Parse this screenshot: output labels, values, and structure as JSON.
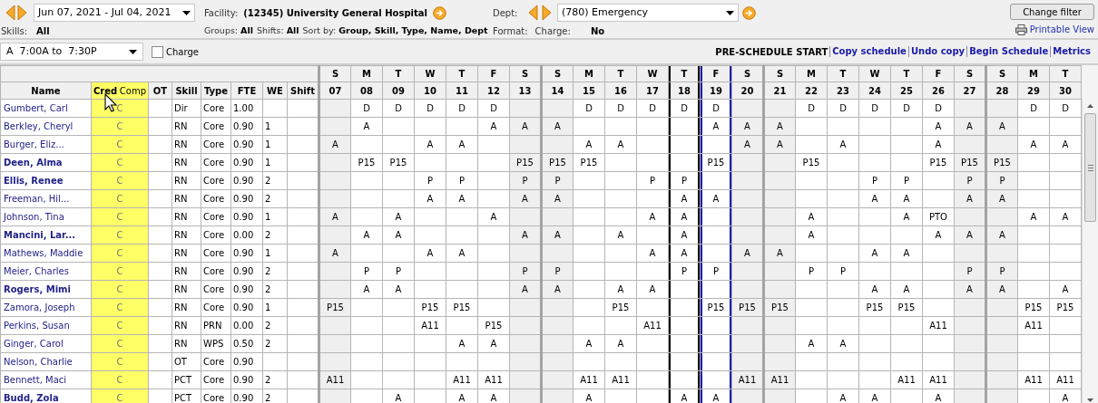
{
  "toolbar": {
    "date_range": "Jun 07, 2021 - Jul 04, 2021",
    "facility_label": "Facility:",
    "facility": "(12345) University General Hospital",
    "dept_label": "Dept:",
    "dept": "(780) Emergency",
    "change_filter": "Change filter",
    "printable_view": "Printable View"
  },
  "skills": {
    "label": "Skills:",
    "value": "All"
  },
  "filters_left": [
    {
      "label": "Groups:",
      "value": "All"
    },
    {
      "label": "Shifts:",
      "value": "All"
    },
    {
      "label": "Sort by:",
      "value": "Group, Skill, Type, Name, Dept"
    }
  ],
  "filters_right": [
    {
      "label": "Format:"
    },
    {
      "label": "Charge:",
      "value": "No"
    }
  ],
  "shift_select": "A  7:00A to  7:30P",
  "charge_checkbox": {
    "label": "Charge",
    "checked": false
  },
  "status": "PRE-SCHEDULE START",
  "links": [
    "Copy schedule",
    "Undo copy",
    "Begin Schedule",
    "Metrics"
  ],
  "columns": [
    "Name",
    "Cred",
    "Comp",
    "OT",
    "Skill",
    "Type",
    "FTE",
    "WE",
    "Shift"
  ],
  "days": [
    {
      "weekday": "S",
      "date": "07",
      "weekend": true,
      "today": false,
      "selected": false
    },
    {
      "weekday": "M",
      "date": "08",
      "weekend": false,
      "today": false,
      "selected": false
    },
    {
      "weekday": "T",
      "date": "09",
      "weekend": false,
      "today": false,
      "selected": false
    },
    {
      "weekday": "W",
      "date": "10",
      "weekend": false,
      "today": false,
      "selected": false
    },
    {
      "weekday": "T",
      "date": "11",
      "weekend": false,
      "today": false,
      "selected": false
    },
    {
      "weekday": "F",
      "date": "12",
      "weekend": false,
      "today": false,
      "selected": false
    },
    {
      "weekday": "S",
      "date": "13",
      "weekend": true,
      "today": false,
      "selected": false
    },
    {
      "weekday": "S",
      "date": "14",
      "weekend": true,
      "today": false,
      "selected": false
    },
    {
      "weekday": "M",
      "date": "15",
      "weekend": false,
      "today": false,
      "selected": false
    },
    {
      "weekday": "T",
      "date": "16",
      "weekend": false,
      "today": false,
      "selected": false
    },
    {
      "weekday": "W",
      "date": "17",
      "weekend": false,
      "today": false,
      "selected": false
    },
    {
      "weekday": "T",
      "date": "18",
      "weekend": false,
      "today": true,
      "selected": false
    },
    {
      "weekday": "F",
      "date": "19",
      "weekend": false,
      "today": false,
      "selected": true
    },
    {
      "weekday": "S",
      "date": "20",
      "weekend": true,
      "today": false,
      "selected": false
    },
    {
      "weekday": "S",
      "date": "21",
      "weekend": true,
      "today": false,
      "selected": false
    },
    {
      "weekday": "M",
      "date": "22",
      "weekend": false,
      "today": false,
      "selected": false
    },
    {
      "weekday": "T",
      "date": "23",
      "weekend": false,
      "today": false,
      "selected": false
    },
    {
      "weekday": "W",
      "date": "24",
      "weekend": false,
      "today": false,
      "selected": false
    },
    {
      "weekday": "T",
      "date": "25",
      "weekend": false,
      "today": false,
      "selected": false
    },
    {
      "weekday": "F",
      "date": "26",
      "weekend": false,
      "today": false,
      "selected": false
    },
    {
      "weekday": "S",
      "date": "27",
      "weekend": true,
      "today": false,
      "selected": false
    },
    {
      "weekday": "S",
      "date": "28",
      "weekend": true,
      "today": false,
      "selected": false
    },
    {
      "weekday": "M",
      "date": "29",
      "weekend": false,
      "today": false,
      "selected": false
    },
    {
      "weekday": "T",
      "date": "30",
      "weekend": false,
      "today": false,
      "selected": false
    }
  ],
  "rows": [
    {
      "name": "Gumbert, Carl",
      "bold": false,
      "cred": "C",
      "skill": "Dir",
      "type": "Core",
      "fte": "1.00",
      "shifts": [
        {
          "kind": "empty"
        },
        {
          "kind": "shift",
          "code": "D"
        },
        {
          "kind": "shift",
          "code": "D"
        },
        {
          "kind": "shift",
          "code": "D"
        },
        {
          "kind": "shift",
          "code": "D"
        },
        {
          "kind": "shift",
          "code": "D"
        },
        {
          "kind": "empty"
        },
        {
          "kind": "empty"
        },
        {
          "kind": "shift",
          "code": "D"
        },
        {
          "kind": "shift",
          "code": "D"
        },
        {
          "kind": "shift",
          "code": "D"
        },
        {
          "kind": "shift",
          "code": "D"
        },
        {
          "kind": "shift",
          "code": "D"
        },
        {
          "kind": "empty"
        },
        {
          "kind": "empty"
        },
        {
          "kind": "shift",
          "code": "D"
        },
        {
          "kind": "shift",
          "code": "D"
        },
        {
          "kind": "shift",
          "code": "D"
        },
        {
          "kind": "shift",
          "code": "D"
        },
        {
          "kind": "shift",
          "code": "D"
        },
        {
          "kind": "empty"
        },
        {
          "kind": "empty"
        },
        {
          "kind": "shift",
          "code": "D"
        },
        {
          "kind": "shift",
          "code": "D"
        }
      ]
    },
    {
      "name": "Berkley, Cheryl",
      "bold": false,
      "cred": "C",
      "skill": "RN",
      "type": "Core",
      "fte": "0.90",
      "we": "1",
      "shifts": [
        {
          "kind": "empty"
        },
        {
          "kind": "shift",
          "code": "A"
        },
        {
          "kind": "empty"
        },
        {
          "kind": "empty"
        },
        {
          "kind": "empty"
        },
        {
          "kind": "shift",
          "code": "A"
        },
        {
          "kind": "shift",
          "code": "A"
        },
        {
          "kind": "shift",
          "code": "A"
        },
        {
          "kind": "empty"
        },
        {
          "kind": "empty"
        },
        {
          "kind": "empty"
        },
        {
          "kind": "empty"
        },
        {
          "kind": "shift",
          "code": "A"
        },
        {
          "kind": "shift",
          "code": "A"
        },
        {
          "kind": "shift",
          "code": "A"
        },
        {
          "kind": "empty"
        },
        {
          "kind": "empty"
        },
        {
          "kind": "empty"
        },
        {
          "kind": "empty"
        },
        {
          "kind": "shift",
          "code": "A"
        },
        {
          "kind": "shift",
          "code": "A"
        },
        {
          "kind": "shift",
          "code": "A"
        },
        {
          "kind": "empty"
        },
        {
          "kind": "empty"
        }
      ]
    },
    {
      "name": "Burger, Eliz...",
      "bold": false,
      "cred": "C",
      "skill": "RN",
      "type": "Core",
      "fte": "0.90",
      "we": "1",
      "shifts": [
        {
          "kind": "shift",
          "code": "A"
        },
        {
          "kind": "empty"
        },
        {
          "kind": "empty"
        },
        {
          "kind": "shift",
          "code": "A"
        },
        {
          "kind": "shift",
          "code": "A"
        },
        {
          "kind": "empty"
        },
        {
          "kind": "empty"
        },
        {
          "kind": "empty"
        },
        {
          "kind": "shift",
          "code": "A"
        },
        {
          "kind": "shift",
          "code": "A"
        },
        {
          "kind": "empty"
        },
        {
          "kind": "empty"
        },
        {
          "kind": "empty"
        },
        {
          "kind": "shift",
          "code": "A"
        },
        {
          "kind": "shift",
          "code": "A"
        },
        {
          "kind": "empty"
        },
        {
          "kind": "shift",
          "code": "A"
        },
        {
          "kind": "empty"
        },
        {
          "kind": "empty"
        },
        {
          "kind": "shift",
          "code": "A"
        },
        {
          "kind": "empty"
        },
        {
          "kind": "empty"
        },
        {
          "kind": "shift",
          "code": "A"
        },
        {
          "kind": "shift",
          "code": "A"
        }
      ]
    },
    {
      "name": "Deen, Alma",
      "bold": true,
      "cred": "C",
      "skill": "RN",
      "type": "Core",
      "fte": "0.90",
      "we": "1",
      "shifts": [
        {
          "kind": "empty"
        },
        {
          "kind": "shift",
          "code": "P15"
        },
        {
          "kind": "shift",
          "code": "P15"
        },
        {
          "kind": "empty"
        },
        {
          "kind": "empty"
        },
        {
          "kind": "empty"
        },
        {
          "kind": "shift",
          "code": "P15"
        },
        {
          "kind": "shift",
          "code": "P15"
        },
        {
          "kind": "shift",
          "code": "P15"
        },
        {
          "kind": "empty"
        },
        {
          "kind": "empty"
        },
        {
          "kind": "empty"
        },
        {
          "kind": "shift",
          "code": "P15"
        },
        {
          "kind": "empty"
        },
        {
          "kind": "empty"
        },
        {
          "kind": "shift",
          "code": "P15"
        },
        {
          "kind": "empty"
        },
        {
          "kind": "empty"
        },
        {
          "kind": "empty"
        },
        {
          "kind": "shift",
          "code": "P15"
        },
        {
          "kind": "shift",
          "code": "P15"
        },
        {
          "kind": "shift",
          "code": "P15"
        },
        {
          "kind": "empty"
        },
        {
          "kind": "empty"
        }
      ]
    },
    {
      "name": "Ellis, Renee",
      "bold": true,
      "cred": "C",
      "skill": "RN",
      "type": "Core",
      "fte": "0.90",
      "we": "2",
      "shifts": [
        {
          "kind": "empty"
        },
        {
          "kind": "empty"
        },
        {
          "kind": "empty"
        },
        {
          "kind": "shift",
          "code": "P"
        },
        {
          "kind": "shift",
          "code": "P"
        },
        {
          "kind": "empty"
        },
        {
          "kind": "shift",
          "code": "P"
        },
        {
          "kind": "shift",
          "code": "P"
        },
        {
          "kind": "empty"
        },
        {
          "kind": "empty"
        },
        {
          "kind": "shift",
          "code": "P"
        },
        {
          "kind": "shift",
          "code": "P"
        },
        {
          "kind": "empty"
        },
        {
          "kind": "empty"
        },
        {
          "kind": "empty"
        },
        {
          "kind": "empty"
        },
        {
          "kind": "empty"
        },
        {
          "kind": "shift",
          "code": "P"
        },
        {
          "kind": "shift",
          "code": "P"
        },
        {
          "kind": "empty"
        },
        {
          "kind": "shift",
          "code": "P"
        },
        {
          "kind": "shift",
          "code": "P"
        },
        {
          "kind": "empty"
        },
        {
          "kind": "empty"
        }
      ]
    },
    {
      "name": "Freeman, Hil...",
      "bold": false,
      "cred": "C",
      "skill": "RN",
      "type": "Core",
      "fte": "0.90",
      "we": "2",
      "shifts": [
        {
          "kind": "empty"
        },
        {
          "kind": "empty"
        },
        {
          "kind": "empty"
        },
        {
          "kind": "shift",
          "code": "A"
        },
        {
          "kind": "shift",
          "code": "A"
        },
        {
          "kind": "empty"
        },
        {
          "kind": "shift",
          "code": "A"
        },
        {
          "kind": "shift",
          "code": "A"
        },
        {
          "kind": "empty"
        },
        {
          "kind": "empty"
        },
        {
          "kind": "empty"
        },
        {
          "kind": "shift",
          "code": "A"
        },
        {
          "kind": "shift",
          "code": "A"
        },
        {
          "kind": "empty"
        },
        {
          "kind": "empty"
        },
        {
          "kind": "empty"
        },
        {
          "kind": "empty"
        },
        {
          "kind": "shift",
          "code": "A"
        },
        {
          "kind": "shift",
          "code": "A"
        },
        {
          "kind": "empty"
        },
        {
          "kind": "shift",
          "code": "A"
        },
        {
          "kind": "shift",
          "code": "A"
        },
        {
          "kind": "empty"
        },
        {
          "kind": "empty"
        }
      ]
    },
    {
      "name": "Johnson, Tina",
      "bold": false,
      "cred": "C",
      "skill": "RN",
      "type": "Core",
      "fte": "0.90",
      "we": "1",
      "shifts": [
        {
          "kind": "shift",
          "code": "A"
        },
        {
          "kind": "empty"
        },
        {
          "kind": "shift",
          "code": "A"
        },
        {
          "kind": "empty"
        },
        {
          "kind": "empty"
        },
        {
          "kind": "shift",
          "code": "A"
        },
        {
          "kind": "empty"
        },
        {
          "kind": "empty"
        },
        {
          "kind": "empty"
        },
        {
          "kind": "empty"
        },
        {
          "kind": "shift",
          "code": "A"
        },
        {
          "kind": "shift",
          "code": "A"
        },
        {
          "kind": "empty"
        },
        {
          "kind": "empty"
        },
        {
          "kind": "empty"
        },
        {
          "kind": "shift",
          "code": "A"
        },
        {
          "kind": "empty"
        },
        {
          "kind": "empty"
        },
        {
          "kind": "shift",
          "code": "A"
        },
        {
          "kind": "shift",
          "code": "PTO"
        },
        {
          "kind": "empty"
        },
        {
          "kind": "empty"
        },
        {
          "kind": "shift",
          "code": "A"
        },
        {
          "kind": "shift",
          "code": "A"
        }
      ]
    },
    {
      "name": "Mancini, Lar...",
      "bold": true,
      "cred": "C",
      "skill": "RN",
      "type": "Core",
      "fte": "0.00",
      "we": "2",
      "shifts": [
        {
          "kind": "empty"
        },
        {
          "kind": "shift",
          "code": "A"
        },
        {
          "kind": "shift",
          "code": "A"
        },
        {
          "kind": "empty"
        },
        {
          "kind": "empty"
        },
        {
          "kind": "empty"
        },
        {
          "kind": "shift",
          "code": "A"
        },
        {
          "kind": "shift",
          "code": "A"
        },
        {
          "kind": "empty"
        },
        {
          "kind": "shift",
          "code": "A"
        },
        {
          "kind": "empty"
        },
        {
          "kind": "shift",
          "code": "A"
        },
        {
          "kind": "empty"
        },
        {
          "kind": "empty"
        },
        {
          "kind": "empty"
        },
        {
          "kind": "shift",
          "code": "A"
        },
        {
          "kind": "empty"
        },
        {
          "kind": "empty"
        },
        {
          "kind": "empty"
        },
        {
          "kind": "shift",
          "code": "A"
        },
        {
          "kind": "shift",
          "code": "A"
        },
        {
          "kind": "shift",
          "code": "A"
        },
        {
          "kind": "empty"
        },
        {
          "kind": "empty"
        }
      ]
    },
    {
      "name": "Mathews, Maddie",
      "bold": false,
      "cred": "C",
      "skill": "RN",
      "type": "Core",
      "fte": "0.90",
      "we": "1",
      "shifts": [
        {
          "kind": "shift",
          "code": "A"
        },
        {
          "kind": "empty"
        },
        {
          "kind": "empty"
        },
        {
          "kind": "shift",
          "code": "A"
        },
        {
          "kind": "shift",
          "code": "A"
        },
        {
          "kind": "empty"
        },
        {
          "kind": "empty"
        },
        {
          "kind": "empty"
        },
        {
          "kind": "empty"
        },
        {
          "kind": "empty"
        },
        {
          "kind": "shift",
          "code": "A"
        },
        {
          "kind": "shift",
          "code": "A"
        },
        {
          "kind": "empty"
        },
        {
          "kind": "shift",
          "code": "A"
        },
        {
          "kind": "shift",
          "code": "A"
        },
        {
          "kind": "empty"
        },
        {
          "kind": "empty"
        },
        {
          "kind": "shift",
          "code": "A"
        },
        {
          "kind": "shift",
          "code": "A"
        },
        {
          "kind": "empty"
        },
        {
          "kind": "empty"
        },
        {
          "kind": "empty"
        },
        {
          "kind": "empty"
        },
        {
          "kind": "empty"
        }
      ]
    },
    {
      "name": "Meier, Charles",
      "bold": false,
      "cred": "C",
      "skill": "RN",
      "type": "Core",
      "fte": "0.90",
      "we": "2",
      "shifts": [
        {
          "kind": "empty"
        },
        {
          "kind": "shift",
          "code": "P"
        },
        {
          "kind": "shift",
          "code": "P"
        },
        {
          "kind": "empty"
        },
        {
          "kind": "empty"
        },
        {
          "kind": "empty"
        },
        {
          "kind": "shift",
          "code": "P"
        },
        {
          "kind": "shift",
          "code": "P"
        },
        {
          "kind": "empty"
        },
        {
          "kind": "empty"
        },
        {
          "kind": "empty"
        },
        {
          "kind": "shift",
          "code": "P"
        },
        {
          "kind": "shift",
          "code": "P"
        },
        {
          "kind": "empty"
        },
        {
          "kind": "empty"
        },
        {
          "kind": "shift",
          "code": "P"
        },
        {
          "kind": "shift",
          "code": "P"
        },
        {
          "kind": "empty"
        },
        {
          "kind": "empty"
        },
        {
          "kind": "empty"
        },
        {
          "kind": "shift",
          "code": "P"
        },
        {
          "kind": "shift",
          "code": "P"
        },
        {
          "kind": "empty"
        },
        {
          "kind": "empty"
        }
      ]
    },
    {
      "name": "Rogers, Mimi",
      "bold": true,
      "cred": "C",
      "skill": "RN",
      "type": "Core",
      "fte": "0.90",
      "we": "2",
      "shifts": [
        {
          "kind": "empty"
        },
        {
          "kind": "shift",
          "code": "A"
        },
        {
          "kind": "shift",
          "code": "A"
        },
        {
          "kind": "empty"
        },
        {
          "kind": "empty"
        },
        {
          "kind": "empty"
        },
        {
          "kind": "shift",
          "code": "A"
        },
        {
          "kind": "shift",
          "code": "A"
        },
        {
          "kind": "empty"
        },
        {
          "kind": "shift",
          "code": "A"
        },
        {
          "kind": "shift",
          "code": "A"
        },
        {
          "kind": "empty"
        },
        {
          "kind": "empty"
        },
        {
          "kind": "empty"
        },
        {
          "kind": "empty"
        },
        {
          "kind": "empty"
        },
        {
          "kind": "empty"
        },
        {
          "kind": "shift",
          "code": "A"
        },
        {
          "kind": "shift",
          "code": "A"
        },
        {
          "kind": "empty"
        },
        {
          "kind": "shift",
          "code": "A"
        },
        {
          "kind": "shift",
          "code": "A"
        },
        {
          "kind": "empty"
        },
        {
          "kind": "shift",
          "code": "A"
        }
      ]
    },
    {
      "name": "Zamora, Joseph",
      "bold": false,
      "cred": "C",
      "skill": "RN",
      "type": "Core",
      "fte": "0.90",
      "we": "1",
      "shifts": [
        {
          "kind": "shift",
          "code": "P15"
        },
        {
          "kind": "empty"
        },
        {
          "kind": "empty"
        },
        {
          "kind": "shift",
          "code": "P15"
        },
        {
          "kind": "shift",
          "code": "P15"
        },
        {
          "kind": "empty"
        },
        {
          "kind": "empty"
        },
        {
          "kind": "empty"
        },
        {
          "kind": "empty"
        },
        {
          "kind": "shift",
          "code": "P15"
        },
        {
          "kind": "empty"
        },
        {
          "kind": "empty"
        },
        {
          "kind": "shift",
          "code": "P15"
        },
        {
          "kind": "shift",
          "code": "P15"
        },
        {
          "kind": "shift",
          "code": "P15"
        },
        {
          "kind": "empty"
        },
        {
          "kind": "empty"
        },
        {
          "kind": "shift",
          "code": "P15"
        },
        {
          "kind": "shift",
          "code": "P15"
        },
        {
          "kind": "empty"
        },
        {
          "kind": "empty"
        },
        {
          "kind": "empty"
        },
        {
          "kind": "shift",
          "code": "P15"
        },
        {
          "kind": "shift",
          "code": "P15"
        }
      ]
    },
    {
      "name": "Perkins, Susan",
      "bold": false,
      "cred": "C",
      "skill": "RN",
      "type": "PRN",
      "fte": "0.00",
      "we": "2",
      "shifts": [
        {
          "kind": "empty"
        },
        {
          "kind": "empty"
        },
        {
          "kind": "empty"
        },
        {
          "kind": "shift",
          "code": "A11"
        },
        {
          "kind": "empty"
        },
        {
          "kind": "shift",
          "code": "P15"
        },
        {
          "kind": "empty"
        },
        {
          "kind": "empty"
        },
        {
          "kind": "empty"
        },
        {
          "kind": "empty"
        },
        {
          "kind": "shift",
          "code": "A11"
        },
        {
          "kind": "empty"
        },
        {
          "kind": "empty"
        },
        {
          "kind": "empty"
        },
        {
          "kind": "empty"
        },
        {
          "kind": "empty"
        },
        {
          "kind": "empty"
        },
        {
          "kind": "empty"
        },
        {
          "kind": "empty"
        },
        {
          "kind": "shift",
          "code": "A11"
        },
        {
          "kind": "empty"
        },
        {
          "kind": "empty"
        },
        {
          "kind": "shift",
          "code": "A11"
        },
        {
          "kind": "empty"
        }
      ]
    },
    {
      "name": "Ginger, Carol",
      "bold": false,
      "cred": "C",
      "skill": "RN",
      "type": "WPS",
      "fte": "0.50",
      "we": "2",
      "shifts": [
        {
          "kind": "empty"
        },
        {
          "kind": "empty"
        },
        {
          "kind": "empty"
        },
        {
          "kind": "empty"
        },
        {
          "kind": "shift",
          "code": "A"
        },
        {
          "kind": "shift",
          "code": "A"
        },
        {
          "kind": "empty"
        },
        {
          "kind": "empty"
        },
        {
          "kind": "shift",
          "code": "A"
        },
        {
          "kind": "shift",
          "code": "A"
        },
        {
          "kind": "empty"
        },
        {
          "kind": "empty"
        },
        {
          "kind": "empty"
        },
        {
          "kind": "empty"
        },
        {
          "kind": "empty"
        },
        {
          "kind": "shift",
          "code": "A"
        },
        {
          "kind": "shift",
          "code": "A"
        },
        {
          "kind": "empty"
        },
        {
          "kind": "empty"
        },
        {
          "kind": "empty"
        },
        {
          "kind": "empty"
        },
        {
          "kind": "empty"
        },
        {
          "kind": "empty"
        },
        {
          "kind": "empty"
        }
      ]
    },
    {
      "name": "Nelson, Charlie",
      "bold": false,
      "cred": "C",
      "skill": "OT",
      "type": "Core",
      "fte": "0.90",
      "shifts": [
        {
          "kind": "empty"
        },
        {
          "kind": "empty"
        },
        {
          "kind": "empty"
        },
        {
          "kind": "empty"
        },
        {
          "kind": "empty"
        },
        {
          "kind": "empty"
        },
        {
          "kind": "empty"
        },
        {
          "kind": "empty"
        },
        {
          "kind": "empty"
        },
        {
          "kind": "empty"
        },
        {
          "kind": "empty"
        },
        {
          "kind": "empty"
        },
        {
          "kind": "empty"
        },
        {
          "kind": "empty"
        },
        {
          "kind": "empty"
        },
        {
          "kind": "empty"
        },
        {
          "kind": "empty"
        },
        {
          "kind": "empty"
        },
        {
          "kind": "empty"
        },
        {
          "kind": "empty"
        },
        {
          "kind": "empty"
        },
        {
          "kind": "empty"
        },
        {
          "kind": "empty"
        },
        {
          "kind": "empty"
        }
      ]
    },
    {
      "name": "Bennett, Maci",
      "bold": false,
      "cred": "C",
      "skill": "PCT",
      "type": "Core",
      "fte": "0.90",
      "we": "2",
      "shifts": [
        {
          "kind": "shift",
          "code": "A11"
        },
        {
          "kind": "empty"
        },
        {
          "kind": "empty"
        },
        {
          "kind": "empty"
        },
        {
          "kind": "shift",
          "code": "A11"
        },
        {
          "kind": "shift",
          "code": "A11"
        },
        {
          "kind": "empty"
        },
        {
          "kind": "empty"
        },
        {
          "kind": "shift",
          "code": "A11"
        },
        {
          "kind": "shift",
          "code": "A11"
        },
        {
          "kind": "empty"
        },
        {
          "kind": "empty"
        },
        {
          "kind": "empty"
        },
        {
          "kind": "shift",
          "code": "A11"
        },
        {
          "kind": "shift",
          "code": "A11"
        },
        {
          "kind": "empty"
        },
        {
          "kind": "empty"
        },
        {
          "kind": "empty"
        },
        {
          "kind": "shift",
          "code": "A11"
        },
        {
          "kind": "shift",
          "code": "A11"
        },
        {
          "kind": "empty"
        },
        {
          "kind": "empty"
        },
        {
          "kind": "shift",
          "code": "A11"
        },
        {
          "kind": "shift",
          "code": "A11"
        }
      ]
    },
    {
      "name": "Budd, Zola",
      "bold": true,
      "cred": "C",
      "skill": "PCT",
      "type": "Core",
      "fte": "0.90",
      "we": "2",
      "shifts": [
        {
          "kind": "empty"
        },
        {
          "kind": "empty"
        },
        {
          "kind": "shift",
          "code": "A"
        },
        {
          "kind": "empty"
        },
        {
          "kind": "shift",
          "code": "A"
        },
        {
          "kind": "shift",
          "code": "A"
        },
        {
          "kind": "empty"
        },
        {
          "kind": "empty"
        },
        {
          "kind": "shift",
          "code": "A"
        },
        {
          "kind": "empty"
        },
        {
          "kind": "empty"
        },
        {
          "kind": "shift",
          "code": "A"
        },
        {
          "kind": "shift",
          "code": "A"
        },
        {
          "kind": "empty"
        },
        {
          "kind": "empty"
        },
        {
          "kind": "empty"
        },
        {
          "kind": "shift",
          "code": "A"
        },
        {
          "kind": "shift",
          "code": "A"
        },
        {
          "kind": "empty"
        },
        {
          "kind": "shift",
          "code": "A"
        },
        {
          "kind": "empty"
        },
        {
          "kind": "empty"
        },
        {
          "kind": "empty"
        },
        {
          "kind": "shift",
          "code": "A"
        }
      ]
    }
  ]
}
